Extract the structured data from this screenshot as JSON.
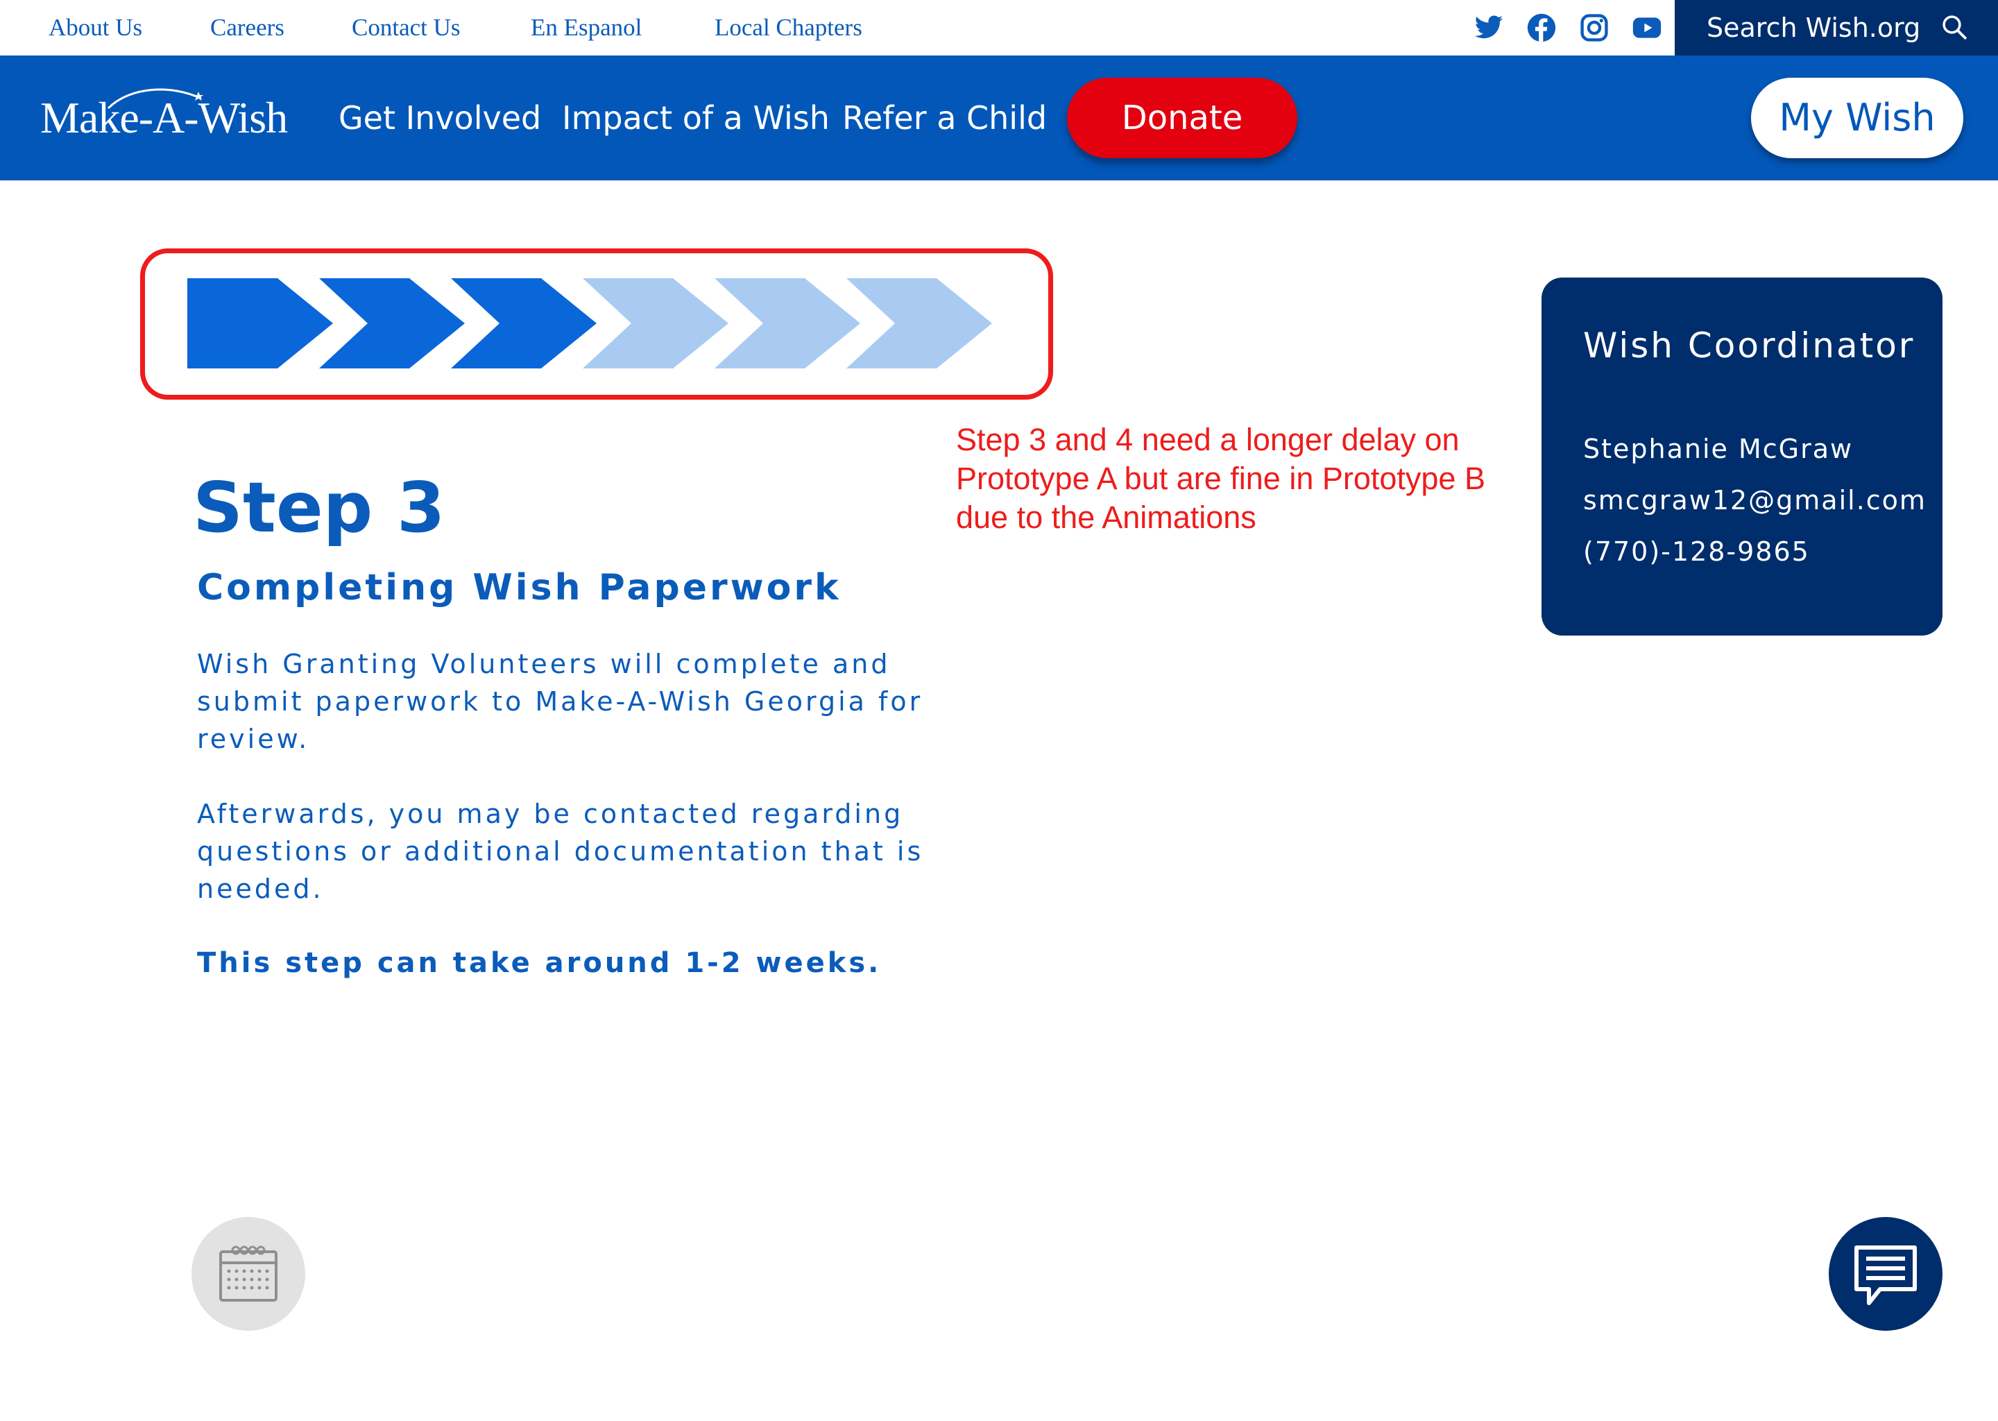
{
  "utility_nav": {
    "links": [
      "About Us",
      "Careers",
      "Contact Us",
      "En Espanol",
      "Local Chapters"
    ],
    "social_icons": [
      "twitter-icon",
      "facebook-icon",
      "instagram-icon",
      "youtube-icon"
    ],
    "search_label": "Search Wish.org"
  },
  "main_nav": {
    "logo": "Make-A-Wish",
    "links": [
      "Get Involved",
      "Impact of a Wish",
      "Refer a Child"
    ],
    "donate_label": "Donate",
    "my_wish_label": "My Wish"
  },
  "progress": {
    "total_steps": 6,
    "current_step": 3,
    "complete_color": "#0a67d9",
    "incomplete_color": "#a9cbf2"
  },
  "annotation": {
    "text": "Step 3 and 4 need a longer delay on Prototype A but are fine in Prototype B due to the Animations",
    "color": "#ee1c1c"
  },
  "step": {
    "title": "Step 3",
    "subtitle": "Completing Wish Paperwork",
    "paragraph1": "Wish Granting Volunteers will complete and submit paperwork to Make-A-Wish Georgia for review.",
    "paragraph2": "Afterwards, you may be contacted regarding questions or additional documentation that is needed.",
    "duration": "This step can take around 1-2 weeks."
  },
  "coordinator": {
    "heading": "Wish Coordinator",
    "name": "Stephanie McGraw",
    "email": "smcgraw12@gmail.com",
    "phone": "(770)-128-9865"
  },
  "floating_buttons": [
    "calendar-icon",
    "chat-icon"
  ],
  "colors": {
    "brand_blue": "#0357b9",
    "navy": "#002d6b",
    "donate_red": "#e3000f",
    "text_blue": "#0b5cba"
  }
}
